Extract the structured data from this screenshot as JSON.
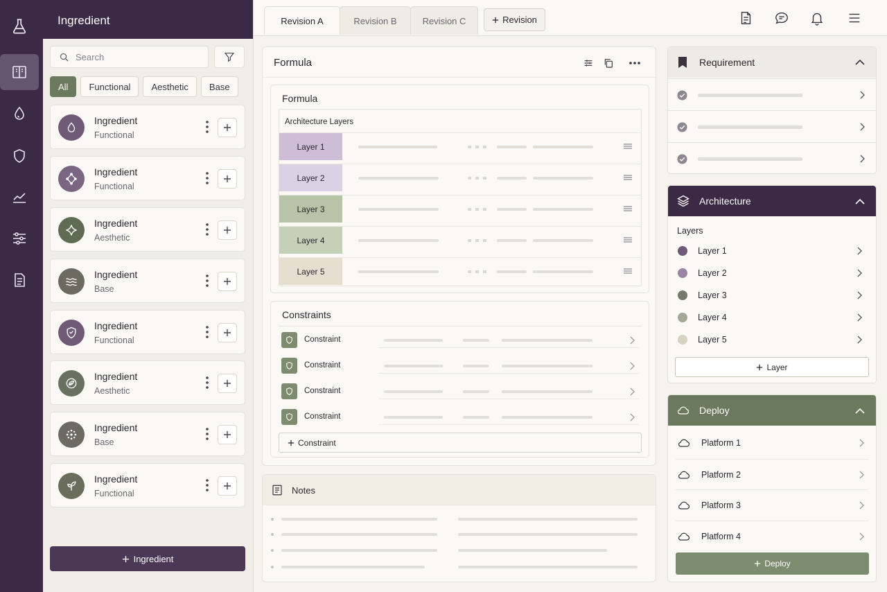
{
  "panel": {
    "title": "Ingredient",
    "search_placeholder": "Search",
    "add_label": "Ingredient"
  },
  "filters": [
    "All",
    "Functional",
    "Aesthetic",
    "Base"
  ],
  "ingredients": [
    {
      "title": "Ingredient",
      "type": "Functional",
      "icon": "droplet-icon"
    },
    {
      "title": "Ingredient",
      "type": "Functional",
      "icon": "molecule-icon"
    },
    {
      "title": "Ingredient",
      "type": "Aesthetic",
      "icon": "sparkle-icon"
    },
    {
      "title": "Ingredient",
      "type": "Base",
      "icon": "waves-icon"
    },
    {
      "title": "Ingredient",
      "type": "Functional",
      "icon": "shield-icon"
    },
    {
      "title": "Ingredient",
      "type": "Aesthetic",
      "icon": "leaf-circle-icon"
    },
    {
      "title": "Ingredient",
      "type": "Base",
      "icon": "dots-cluster-icon"
    },
    {
      "title": "Ingredient",
      "type": "Functional",
      "icon": "sprout-icon"
    }
  ],
  "tabs": [
    "Revision A",
    "Revision B",
    "Revision C"
  ],
  "add_revision": "Revision",
  "formula": {
    "title": "Formula",
    "subtitle": "Formula",
    "layers_title": "Architecture Layers",
    "layers": [
      "Layer 1",
      "Layer 2",
      "Layer 3",
      "Layer 4",
      "Layer 5"
    ],
    "constraints_title": "Constraints",
    "constraints": [
      "Constraint",
      "Constraint",
      "Constraint",
      "Constraint"
    ],
    "add_constraint": "Constraint"
  },
  "notes": {
    "title": "Notes"
  },
  "requirement": {
    "title": "Requirement"
  },
  "architecture": {
    "title": "Architecture",
    "subtitle": "Layers",
    "layers": [
      "Layer 1",
      "Layer 2",
      "Layer 3",
      "Layer 4",
      "Layer 5"
    ],
    "add_label": "Layer"
  },
  "deploy": {
    "title": "Deploy",
    "platforms": [
      "Platform 1",
      "Platform 2",
      "Platform 3",
      "Platform 4"
    ],
    "add_label": "Deploy"
  },
  "colors": {
    "plum": "#3b2a45",
    "sage": "#6b7a5e",
    "layer1": "#cdbdd6",
    "layer2": "#dcd0e4",
    "layer3": "#b7c4a8",
    "layer4": "#c5d0b8",
    "layer5": "#e6dfcf"
  }
}
